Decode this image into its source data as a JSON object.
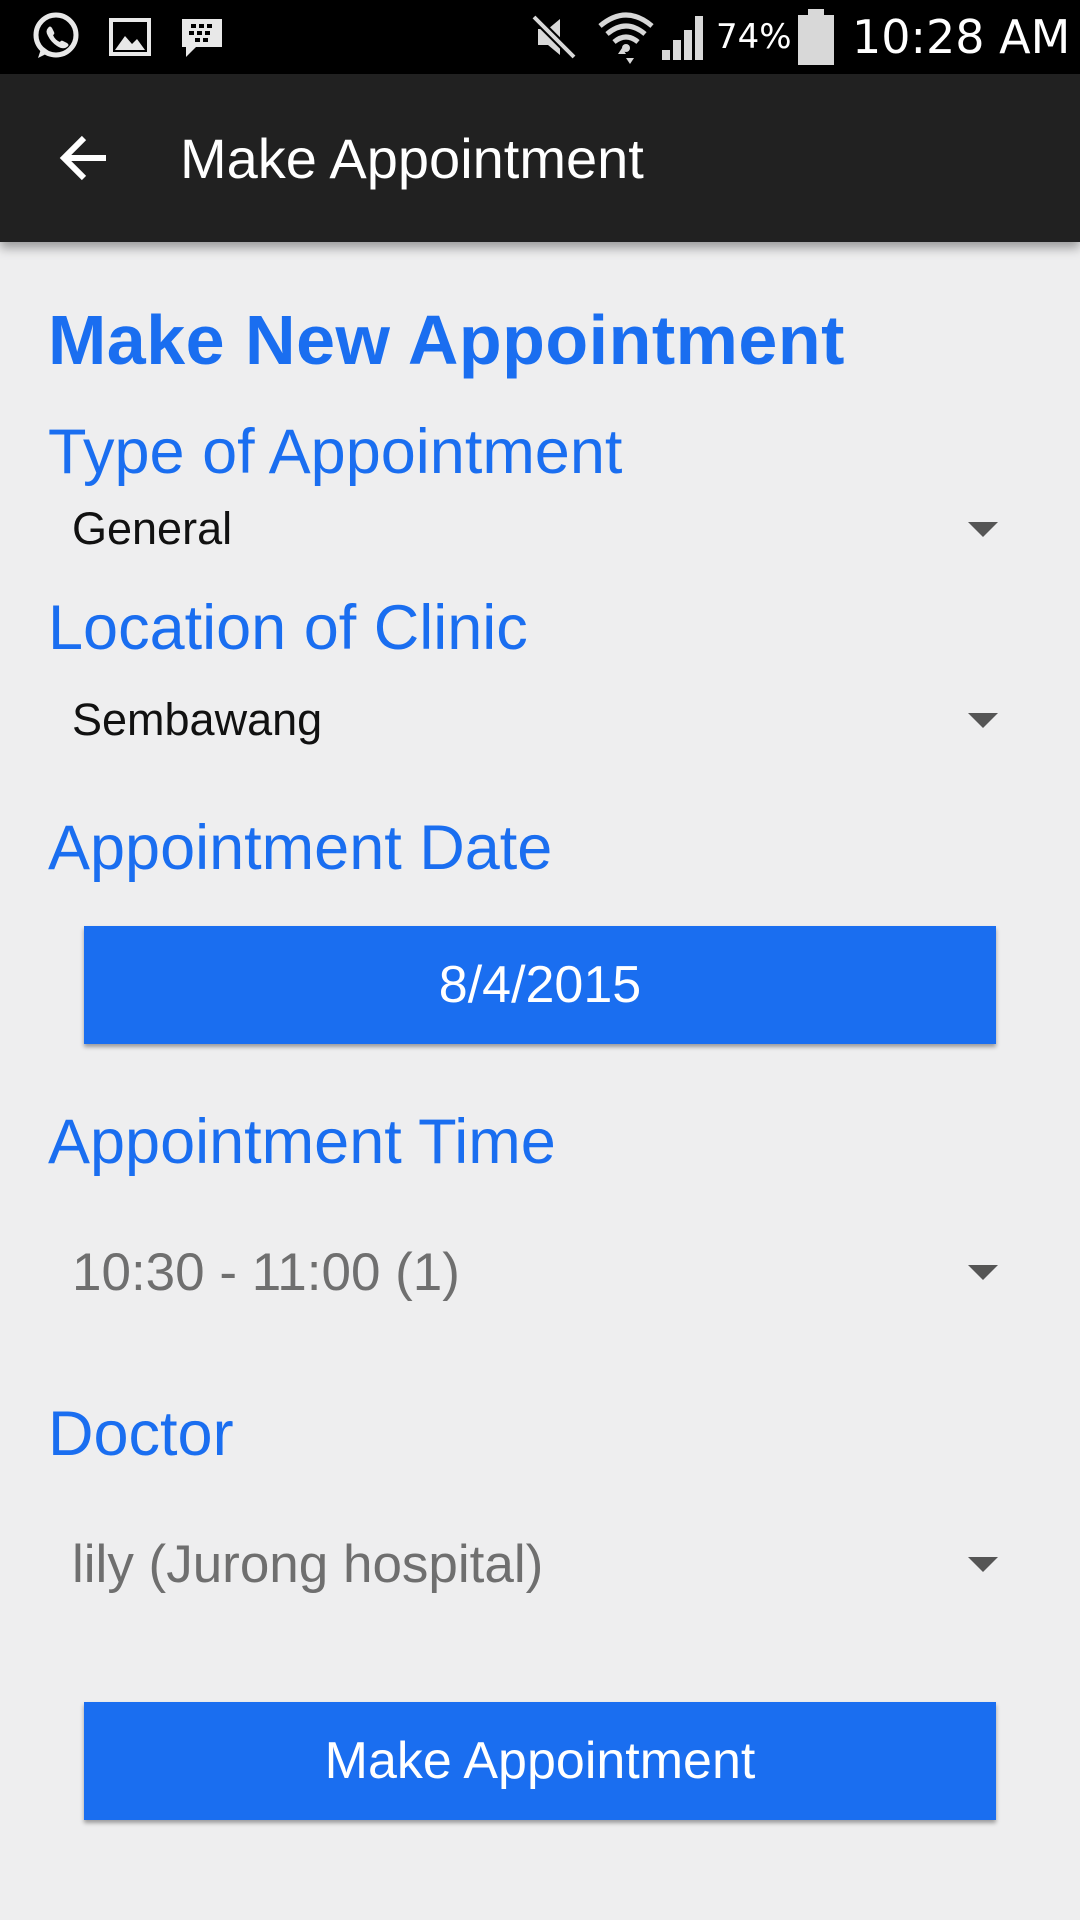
{
  "status_bar": {
    "icons": [
      "whatsapp-icon",
      "gallery-icon",
      "bbm-icon",
      "mute-icon",
      "wifi-icon",
      "signal-icon",
      "battery-icon"
    ],
    "battery": "74%",
    "time": "10:28 AM"
  },
  "app_bar": {
    "back_icon": "back-arrow-icon",
    "title": "Make Appointment"
  },
  "form": {
    "heading": "Make New Appointment",
    "type_label": "Type of Appointment",
    "type_value": "General",
    "location_label": "Location of Clinic",
    "location_value": "Sembawang",
    "date_label": "Appointment Date",
    "date_value": "8/4/2015",
    "time_label": "Appointment Time",
    "time_value": "10:30 - 11:00 (1)",
    "doctor_label": "Doctor",
    "doctor_value": "lily (Jurong hospital)",
    "submit_label": "Make Appointment"
  },
  "colors": {
    "accent": "#1a6ef0",
    "app_bar": "#212121",
    "background": "#eeeeef",
    "status_bar": "#000000"
  }
}
